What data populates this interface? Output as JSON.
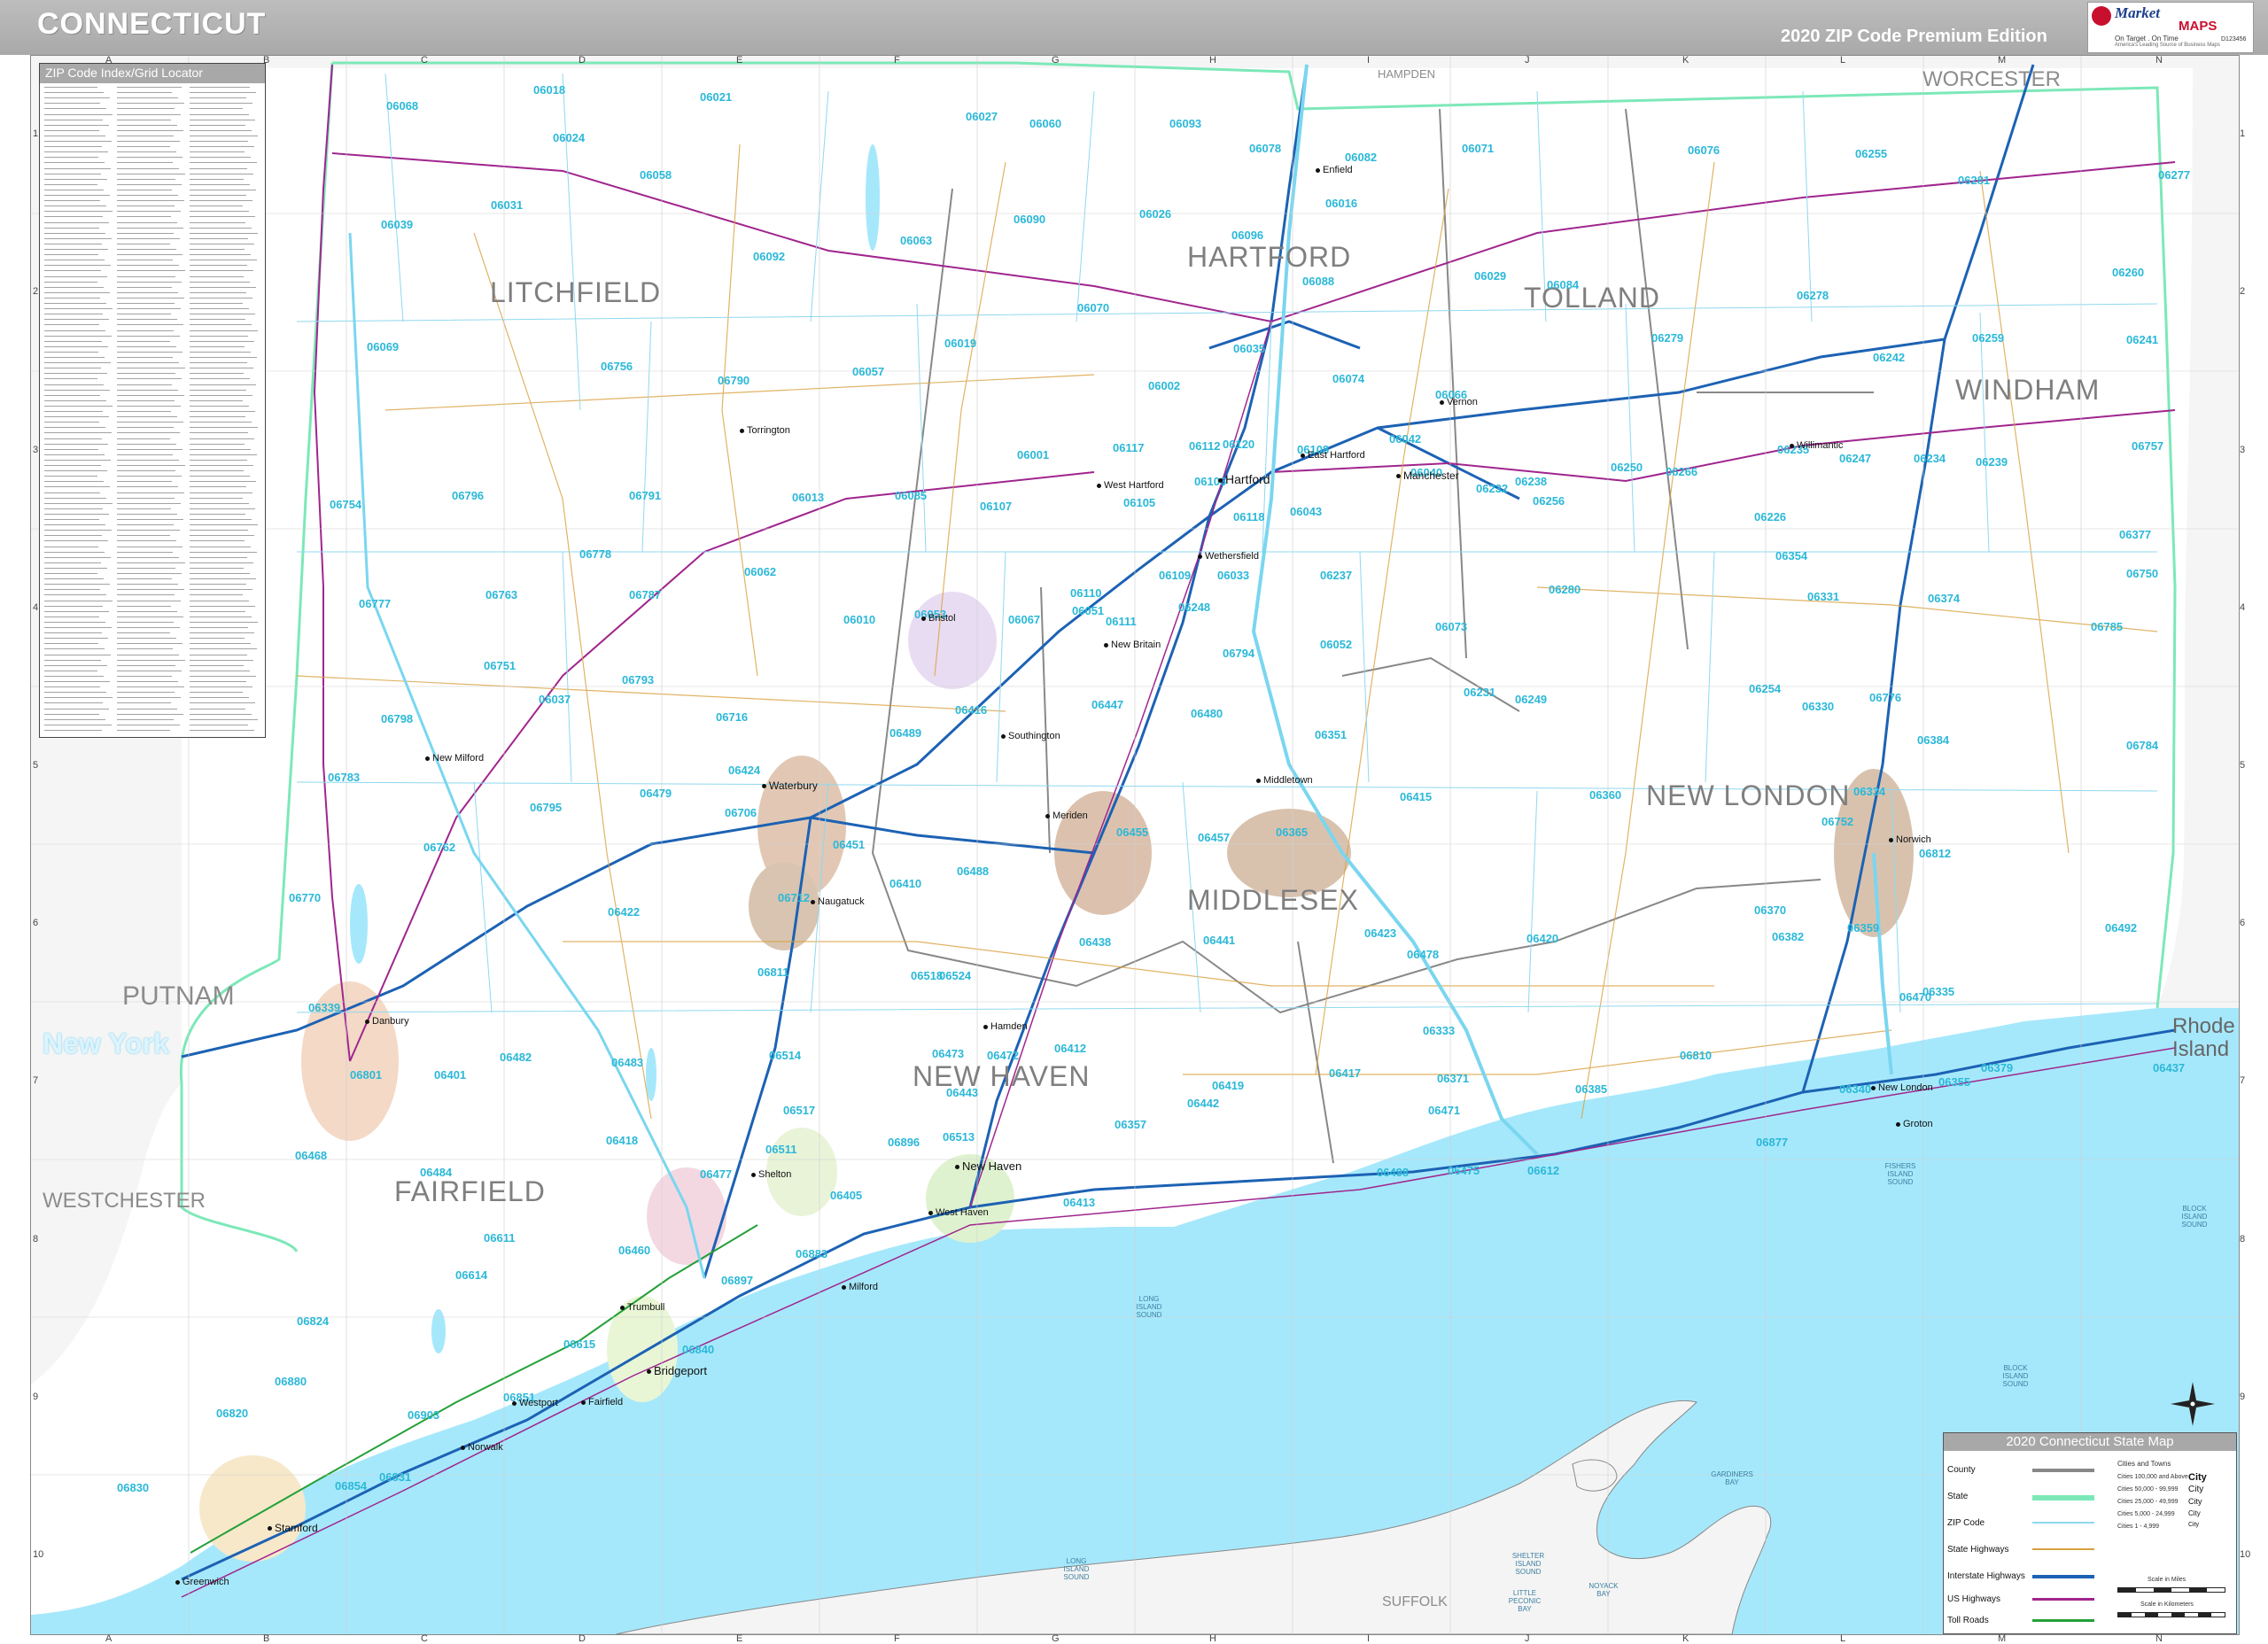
{
  "header": {
    "title": "CONNECTICUT",
    "edition": "2020 ZIP Code Premium Edition"
  },
  "logo": {
    "brand_top": "Market",
    "brand_bottom": "MAPS",
    "tagline": "On Target . On Time",
    "subline": "America's Leading Source of Business Maps",
    "code": "D123456"
  },
  "grid": {
    "columns": [
      "A",
      "B",
      "C",
      "D",
      "E",
      "F",
      "G",
      "H",
      "I",
      "J",
      "K",
      "L",
      "M",
      "N"
    ],
    "rows": [
      "1",
      "2",
      "3",
      "4",
      "5",
      "6",
      "7",
      "8",
      "9",
      "10"
    ]
  },
  "index": {
    "title": "ZIP Code Index/Grid Locator"
  },
  "counties": {
    "litchfield": "LITCHFIELD",
    "hartford": "HARTFORD",
    "tolland": "TOLLAND",
    "windham": "WINDHAM",
    "new_london": "NEW LONDON",
    "middlesex": "MIDDLESEX",
    "new_haven": "NEW HAVEN",
    "fairfield": "FAIRFIELD"
  },
  "neighbors": {
    "worcester": "WORCESTER",
    "putnam": "PUTNAM",
    "westchester": "WESTCHESTER",
    "rhode_island": "Rhode Island",
    "suffolk": "SUFFOLK",
    "hampden": "HAMPDEN"
  },
  "new_york": "New York",
  "zips": [
    {
      "code": "06068"
    },
    {
      "code": "06018"
    },
    {
      "code": "06021"
    },
    {
      "code": "06027"
    },
    {
      "code": "06060"
    },
    {
      "code": "06093"
    },
    {
      "code": "06078"
    },
    {
      "code": "06082"
    },
    {
      "code": "06071"
    },
    {
      "code": "06076"
    },
    {
      "code": "06255"
    },
    {
      "code": "06277"
    },
    {
      "code": "06024"
    },
    {
      "code": "06058"
    },
    {
      "code": "06031"
    },
    {
      "code": "06039"
    },
    {
      "code": "06092"
    },
    {
      "code": "06090"
    },
    {
      "code": "06026"
    },
    {
      "code": "06096"
    },
    {
      "code": "06088"
    },
    {
      "code": "06016"
    },
    {
      "code": "06029"
    },
    {
      "code": "06084"
    },
    {
      "code": "06278"
    },
    {
      "code": "06281"
    },
    {
      "code": "06260"
    },
    {
      "code": "06069"
    },
    {
      "code": "06063"
    },
    {
      "code": "06019"
    },
    {
      "code": "06070"
    },
    {
      "code": "06035"
    },
    {
      "code": "06074"
    },
    {
      "code": "06066"
    },
    {
      "code": "06279"
    },
    {
      "code": "06242"
    },
    {
      "code": "06259"
    },
    {
      "code": "06241"
    },
    {
      "code": "06756"
    },
    {
      "code": "06790"
    },
    {
      "code": "06057"
    },
    {
      "code": "06002"
    },
    {
      "code": "06001"
    },
    {
      "code": "06117"
    },
    {
      "code": "06112"
    },
    {
      "code": "06120"
    },
    {
      "code": "06108"
    },
    {
      "code": "06042"
    },
    {
      "code": "06040"
    },
    {
      "code": "06238"
    },
    {
      "code": "06250"
    },
    {
      "code": "06266"
    },
    {
      "code": "06235"
    },
    {
      "code": "06247"
    },
    {
      "code": "06234"
    },
    {
      "code": "06239"
    },
    {
      "code": "06757"
    },
    {
      "code": "06754"
    },
    {
      "code": "06796"
    },
    {
      "code": "06791"
    },
    {
      "code": "06013"
    },
    {
      "code": "06085"
    },
    {
      "code": "06107"
    },
    {
      "code": "06105"
    },
    {
      "code": "06106"
    },
    {
      "code": "06118"
    },
    {
      "code": "06043"
    },
    {
      "code": "06232"
    },
    {
      "code": "06256"
    },
    {
      "code": "06226"
    },
    {
      "code": "06354"
    },
    {
      "code": "06377"
    },
    {
      "code": "06750"
    },
    {
      "code": "06778"
    },
    {
      "code": "06062"
    },
    {
      "code": "06110"
    },
    {
      "code": "06109"
    },
    {
      "code": "06033"
    },
    {
      "code": "06237"
    },
    {
      "code": "06280"
    },
    {
      "code": "06331"
    },
    {
      "code": "06374"
    },
    {
      "code": "06785"
    },
    {
      "code": "06777"
    },
    {
      "code": "06763"
    },
    {
      "code": "06787"
    },
    {
      "code": "06010"
    },
    {
      "code": "06053"
    },
    {
      "code": "06051"
    },
    {
      "code": "06111"
    },
    {
      "code": "06248"
    },
    {
      "code": "06073"
    },
    {
      "code": "06052"
    },
    {
      "code": "06067"
    },
    {
      "code": "06794"
    },
    {
      "code": "06751"
    },
    {
      "code": "06793"
    },
    {
      "code": "06037"
    },
    {
      "code": "06447"
    },
    {
      "code": "06231"
    },
    {
      "code": "06249"
    },
    {
      "code": "06254"
    },
    {
      "code": "06330"
    },
    {
      "code": "06776"
    },
    {
      "code": "06798"
    },
    {
      "code": "06716"
    },
    {
      "code": "06489"
    },
    {
      "code": "06416"
    },
    {
      "code": "06480"
    },
    {
      "code": "06351"
    },
    {
      "code": "06384"
    },
    {
      "code": "06784"
    },
    {
      "code": "06783"
    },
    {
      "code": "06795"
    },
    {
      "code": "06479"
    },
    {
      "code": "06424"
    },
    {
      "code": "06415"
    },
    {
      "code": "06360"
    },
    {
      "code": "06334"
    },
    {
      "code": "06752"
    },
    {
      "code": "06762"
    },
    {
      "code": "06706"
    },
    {
      "code": "06451"
    },
    {
      "code": "06455"
    },
    {
      "code": "06457"
    },
    {
      "code": "06365"
    },
    {
      "code": "06812"
    },
    {
      "code": "06770"
    },
    {
      "code": "06712"
    },
    {
      "code": "06410"
    },
    {
      "code": "06488"
    },
    {
      "code": "06422"
    },
    {
      "code": "06441"
    },
    {
      "code": "06423"
    },
    {
      "code": "06420"
    },
    {
      "code": "06370"
    },
    {
      "code": "06382"
    },
    {
      "code": "06359"
    },
    {
      "code": "06492"
    },
    {
      "code": "06438"
    },
    {
      "code": "06478"
    },
    {
      "code": "06518"
    },
    {
      "code": "06524"
    },
    {
      "code": "06811"
    },
    {
      "code": "06339"
    },
    {
      "code": "06335"
    },
    {
      "code": "06470"
    },
    {
      "code": "06482"
    },
    {
      "code": "06483"
    },
    {
      "code": "06514"
    },
    {
      "code": "06473"
    },
    {
      "code": "06472"
    },
    {
      "code": "06412"
    },
    {
      "code": "06333"
    },
    {
      "code": "06810"
    },
    {
      "code": "06801"
    },
    {
      "code": "06401"
    },
    {
      "code": "06517"
    },
    {
      "code": "06443"
    },
    {
      "code": "06419"
    },
    {
      "code": "06417"
    },
    {
      "code": "06371"
    },
    {
      "code": "06385"
    },
    {
      "code": "06340"
    },
    {
      "code": "06355"
    },
    {
      "code": "06379"
    },
    {
      "code": "06437"
    },
    {
      "code": "06442"
    },
    {
      "code": "06471"
    },
    {
      "code": "06357"
    },
    {
      "code": "06877"
    },
    {
      "code": "06468"
    },
    {
      "code": "06418"
    },
    {
      "code": "06511"
    },
    {
      "code": "06513"
    },
    {
      "code": "06896"
    },
    {
      "code": "06484"
    },
    {
      "code": "06477"
    },
    {
      "code": "06405"
    },
    {
      "code": "06413"
    },
    {
      "code": "06498"
    },
    {
      "code": "06475"
    },
    {
      "code": "06612"
    },
    {
      "code": "06611"
    },
    {
      "code": "06460"
    },
    {
      "code": "06883"
    },
    {
      "code": "06614"
    },
    {
      "code": "06897"
    },
    {
      "code": "06824"
    },
    {
      "code": "06615"
    },
    {
      "code": "06840"
    },
    {
      "code": "06880"
    },
    {
      "code": "06851"
    },
    {
      "code": "06903"
    },
    {
      "code": "06820"
    },
    {
      "code": "06854"
    },
    {
      "code": "06831"
    },
    {
      "code": "06830"
    }
  ],
  "cities": {
    "west_hartford": "West Hartford",
    "hartford": "Hartford",
    "manchester": "Manchester",
    "east_hartford": "East Hartford",
    "bristol": "Bristol",
    "new_britain": "New Britain",
    "waterbury": "Waterbury",
    "meriden": "Meriden",
    "naugatuck": "Naugatuck",
    "danbury": "Danbury",
    "hamden": "Hamden",
    "new_haven": "New Haven",
    "west_haven": "West Haven",
    "bridgeport": "Bridgeport",
    "norwalk": "Norwalk",
    "stamford": "Stamford",
    "greenwich": "Greenwich",
    "norwich": "Norwich",
    "new_london": "New London",
    "middletown": "Middletown",
    "wethersfield": "Wethersfield",
    "enfield": "Enfield",
    "vernon": "Vernon",
    "fairfield": "Fairfield",
    "westport": "Westport",
    "shelton": "Shelton",
    "milford": "Milford",
    "new_milford": "New Milford",
    "torrington": "Torrington",
    "southington": "Southington",
    "willimantic": "Willimantic",
    "groton": "Groton",
    "trumbull": "Trumbull"
  },
  "water": {
    "lis1": "LONG\nISLAND\nSOUND",
    "lis2": "LONG\nISLAND\nSOUND",
    "fisher": "FISHERS\nISLAND\nSOUND",
    "block_sound": "BLOCK\nISLAND\nSOUND",
    "block_sound2": "BLOCK\nISLAND\nSOUND",
    "gardiners": "GARDINERS\nBAY",
    "peconic": "LITTLE\nPECONIC\nBAY",
    "noyack": "NOYACK\nBAY",
    "shelter": "SHELTER\nISLAND\nSOUND"
  },
  "legend": {
    "title": "2020 Connecticut State Map",
    "items": [
      "County",
      "State",
      "ZIP Code",
      "State Highways",
      "Interstate Highways",
      "US Highways",
      "Toll Roads"
    ],
    "city_header": "Cities and Towns",
    "city_sizes": [
      "Cities 100,000 and Above",
      "Cities 50,000 - 99,999",
      "Cities 25,000 - 49,999",
      "Cities 5,000 - 24,999",
      "Cities 1 - 4,999"
    ],
    "city_symbols": [
      "City",
      "City",
      "City",
      "City",
      "City"
    ],
    "scale_miles": "Scale in Miles",
    "scale_km": "Scale in Kilometers"
  },
  "colors": {
    "water": "#a6e8fb",
    "zip_label": "#2bb8d8",
    "state_border": "#7ce8b8",
    "interstate": "#1c62b4",
    "us_highway": "#a0258e",
    "state_highway": "#d8a040",
    "toll": "#25a038",
    "county_label": "#7f7f7f"
  }
}
